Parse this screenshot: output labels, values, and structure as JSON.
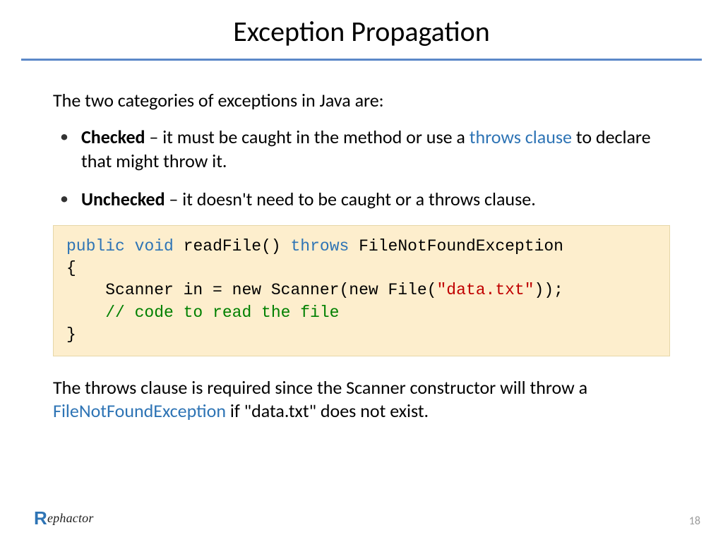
{
  "title": "Exception Propagation",
  "intro": "The two categories of exceptions in Java are:",
  "bullets": {
    "checked": {
      "term": "Checked",
      "before": " – it must be caught in the method or use a ",
      "link": "throws clause",
      "after": " to declare that might throw it."
    },
    "unchecked": {
      "term": "Unchecked",
      "after": " – it doesn't need to be caught or a throws clause."
    }
  },
  "code": {
    "kw_public": "public",
    "kw_void": "void",
    "sig_name": " readFile() ",
    "kw_throws": "throws",
    "sig_exc": " FileNotFoundException",
    "line_open": "{",
    "line_scanner": "    Scanner in = new Scanner(new File(",
    "str_data": "\"data.txt\"",
    "line_scanner_end": "));",
    "comment": "    // code to read the file",
    "line_close": "}"
  },
  "outro": {
    "before": "The throws clause is required since the Scanner constructor will throw a ",
    "link": "FileNotFoundException",
    "after": " if \"data.txt\" does not exist."
  },
  "logo": {
    "r": "R",
    "rest": "ephactor"
  },
  "page_number": "18"
}
